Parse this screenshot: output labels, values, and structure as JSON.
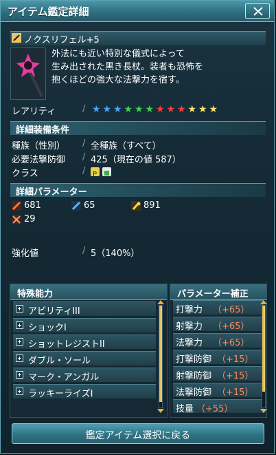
{
  "window": {
    "title": "アイテム鑑定詳細"
  },
  "item": {
    "name": "ノクスリフェル+5",
    "description": "外法にも近い特別な儀式によって\n生み出された黒き長杖。装者も恐怖を\n抱くほどの強大な法撃力を宿す。"
  },
  "rarity": {
    "label": "レアリティ",
    "separator": "/",
    "stars": [
      "#4aa3ff",
      "#4aa3ff",
      "#4aa3ff",
      "#3fd04a",
      "#3fd04a",
      "#3fd04a",
      "#ff3b3b",
      "#ff3b3b",
      "#ff3b3b",
      "#ffe36a",
      "#ffe36a",
      "#ffe36a"
    ]
  },
  "requirements": {
    "header": "詳細装備条件",
    "race_label": "種族（性別）",
    "race_value": "全種族（すべて）",
    "defense_label": "必要法撃防御",
    "defense_value": "425（現在の値 587）",
    "class_label": "クラス",
    "separator": "/"
  },
  "params": {
    "header": "詳細パラメーター",
    "attack": "681",
    "ranged": "65",
    "tech": "891",
    "dex": "29"
  },
  "enhance": {
    "label": "強化値",
    "separator": "/",
    "value": "5（140%）"
  },
  "abilities": {
    "header": "特殊能力",
    "items": [
      "アビリティIII",
      "ショックI",
      "ショットレジストII",
      "ダブル・ソール",
      "マーク・アンガル",
      "ラッキーライズI"
    ]
  },
  "param_bonus": {
    "header": "パラメーター補正",
    "items": [
      {
        "label": "打撃力",
        "value": "（+65）"
      },
      {
        "label": "射撃力",
        "value": "（+65）"
      },
      {
        "label": "法撃力",
        "value": "（+65）"
      },
      {
        "label": "打撃防御",
        "value": "（+15）"
      },
      {
        "label": "射撃防御",
        "value": "（+15）"
      },
      {
        "label": "法撃防御",
        "value": "（+15）"
      },
      {
        "label": "技量",
        "value": "（+55）"
      }
    ]
  },
  "button": {
    "back": "鑑定アイテム選択に戻る"
  }
}
